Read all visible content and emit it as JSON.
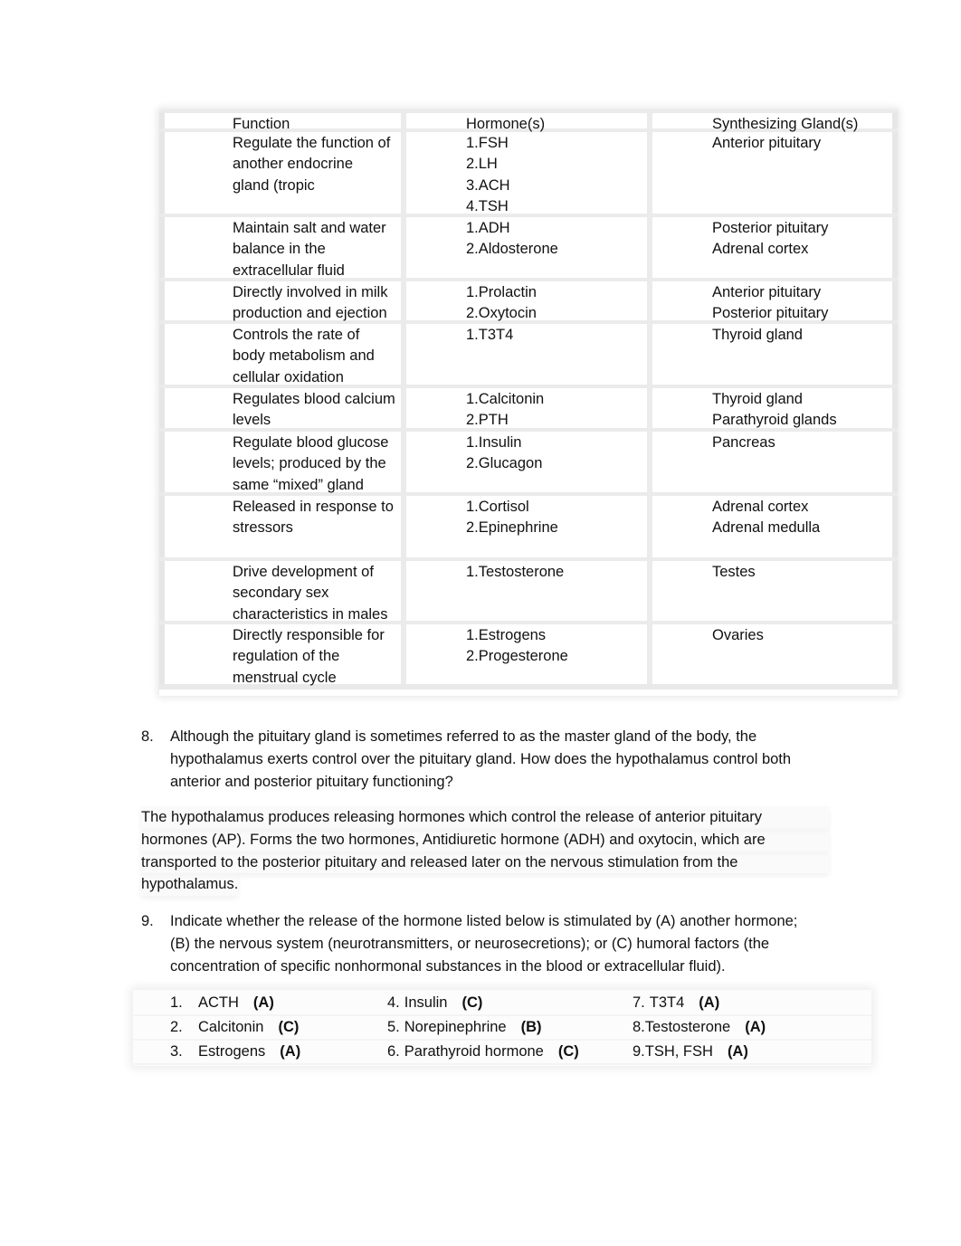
{
  "hormone_table": {
    "headers": {
      "function": "Function",
      "hormones": "Hormone(s)",
      "glands": "Synthesizing Gland(s)"
    },
    "rows": [
      {
        "function": [
          "Regulate the function of",
          "another endocrine",
          "gland (tropic"
        ],
        "hormones": [
          "1.FSH",
          "2.LH",
          "3.ACH",
          "4.TSH"
        ],
        "glands": [
          "Anterior pituitary"
        ]
      },
      {
        "function": [
          "Maintain salt and water",
          "balance in the",
          "extracellular fluid"
        ],
        "hormones": [
          "1.ADH",
          "2.Aldosterone"
        ],
        "glands": [
          "Posterior pituitary",
          "Adrenal cortex"
        ]
      },
      {
        "function": [
          "Directly involved in milk",
          "production and ejection"
        ],
        "hormones": [
          "1.Prolactin",
          "2.Oxytocin"
        ],
        "glands": [
          "Anterior pituitary",
          "Posterior pituitary"
        ]
      },
      {
        "function": [
          "Controls the rate of",
          "body metabolism and",
          "cellular oxidation"
        ],
        "hormones": [
          "1.T3T4"
        ],
        "glands": [
          "Thyroid gland"
        ]
      },
      {
        "function": [
          "Regulates blood calcium",
          "levels"
        ],
        "hormones": [
          "1.Calcitonin",
          "2.PTH"
        ],
        "glands": [
          "Thyroid gland",
          "Parathyroid glands"
        ]
      },
      {
        "function": [
          "Regulate blood glucose",
          "levels; produced by the",
          "same “mixed” gland"
        ],
        "hormones": [
          "1.Insulin",
          "2.Glucagon"
        ],
        "glands": [
          "Pancreas"
        ]
      },
      {
        "function": [
          "Released in response to",
          "stressors",
          ""
        ],
        "hormones": [
          "1.Cortisol",
          "2.Epinephrine"
        ],
        "glands": [
          "Adrenal cortex",
          "Adrenal medulla"
        ]
      },
      {
        "function": [
          "Drive development of",
          "secondary sex",
          "characteristics in males"
        ],
        "hormones": [
          "1.Testosterone"
        ],
        "glands": [
          "Testes"
        ]
      },
      {
        "function": [
          "Directly responsible for",
          "regulation of the",
          "menstrual cycle"
        ],
        "hormones": [
          "1.Estrogens",
          "2.Progesterone"
        ],
        "glands": [
          "Ovaries"
        ]
      }
    ]
  },
  "question_8": {
    "number": "8.",
    "lines": [
      "Although the pituitary gland is sometimes referred to as the master gland of the body, the",
      "hypothalamus exerts control over the pituitary gland. How does the hypothalamus control both",
      "anterior and posterior pituitary functioning?"
    ]
  },
  "answer_8": {
    "lines": [
      "The hypothalamus produces releasing hormones which control the release of anterior pituitary",
      "hormones (AP). Forms the two hormones, Antidiuretic hormone (ADH) and oxytocin, which are",
      "transported to the posterior pituitary and released later on the nervous stimulation from the",
      "hypothalamus."
    ]
  },
  "question_9": {
    "number": "9.",
    "lines": [
      "Indicate whether the release of the hormone listed below is stimulated by (A) another hormone;",
      "(B) the nervous system (neurotransmitters, or neurosecretions); or (C) humoral factors (the",
      "concentration of specific nonhormonal substances in the blood or extracellular fluid)."
    ]
  },
  "answer_9": {
    "rows": [
      [
        {
          "num": "1.",
          "name": "ACTH",
          "answer": "(A)"
        },
        {
          "num": "4.",
          "name": "Insulin",
          "answer": "(C)"
        },
        {
          "num": "7.",
          "name": "T3T4",
          "answer": "(A)"
        }
      ],
      [
        {
          "num": "2.",
          "name": "Calcitonin",
          "answer": "(C)"
        },
        {
          "num": "5.",
          "name": "Norepinephrine",
          "answer": "(B)"
        },
        {
          "num": "8.",
          "name": "Testosterone",
          "answer": "(A)"
        }
      ],
      [
        {
          "num": "3.",
          "name": "Estrogens",
          "answer": "(A)"
        },
        {
          "num": "6.",
          "name": "Parathyroid hormone",
          "answer": "(C)"
        },
        {
          "num": "9.",
          "name": "TSH, FSH",
          "answer": "(A)"
        }
      ]
    ]
  }
}
